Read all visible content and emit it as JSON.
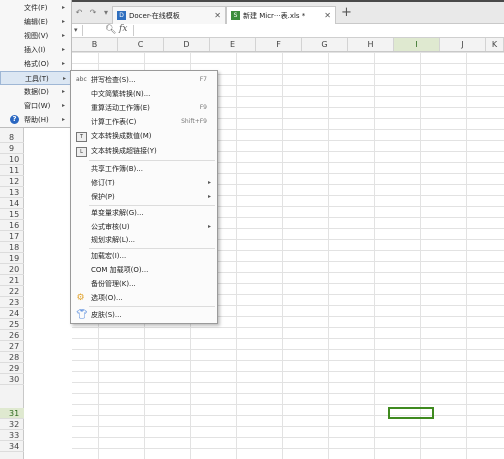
{
  "tabs": [
    {
      "label": "Docer-在线模板",
      "close": "✕"
    },
    {
      "label": "新建 Micr···表.xls *",
      "close": "✕"
    }
  ],
  "new_tab": "+",
  "formula_bar": {
    "fx": "fx"
  },
  "columns": [
    "B",
    "C",
    "D",
    "E",
    "F",
    "G",
    "H",
    "I",
    "J",
    "K"
  ],
  "rows": [
    "8",
    "9",
    "10",
    "11",
    "12",
    "13",
    "14",
    "15",
    "16",
    "17",
    "18",
    "19",
    "20",
    "21",
    "22",
    "23",
    "24",
    "25",
    "26",
    "27",
    "28",
    "29",
    "30",
    "31",
    "32",
    "33",
    "34"
  ],
  "menubar": [
    {
      "label": "文件(F)"
    },
    {
      "label": "编辑(E)"
    },
    {
      "label": "视图(V)"
    },
    {
      "label": "插入(I)"
    },
    {
      "label": "格式(O)"
    },
    {
      "label": "工具(T)"
    },
    {
      "label": "数据(D)"
    },
    {
      "label": "窗口(W)"
    },
    {
      "label": "帮助(H)"
    }
  ],
  "tools_menu": {
    "items": [
      {
        "label": "拼写检查(S)...",
        "shortcut": "F7",
        "icon": "abc"
      },
      {
        "label": "中文简繁转换(N)..."
      },
      {
        "label": "重算活动工作簿(E)",
        "shortcut": "F9"
      },
      {
        "label": "计算工作表(C)",
        "shortcut": "Shift+F9"
      },
      {
        "label": "文本转换成数值(M)",
        "icon": "box"
      },
      {
        "label": "文本转换成超链接(Y)",
        "icon": "box"
      },
      {
        "label": "共享工作簿(B)..."
      },
      {
        "label": "修订(T)"
      },
      {
        "label": "保护(P)"
      },
      {
        "label": "单变量求解(G)..."
      },
      {
        "label": "公式审核(U)"
      },
      {
        "label": "规划求解(L)..."
      },
      {
        "label": "加载宏(I)..."
      },
      {
        "label": "COM 加载项(O)..."
      },
      {
        "label": "备份管理(K)..."
      },
      {
        "label": "选项(O)...",
        "icon": "gear"
      },
      {
        "label": "皮肤(S)...",
        "icon": "shirt"
      }
    ]
  }
}
